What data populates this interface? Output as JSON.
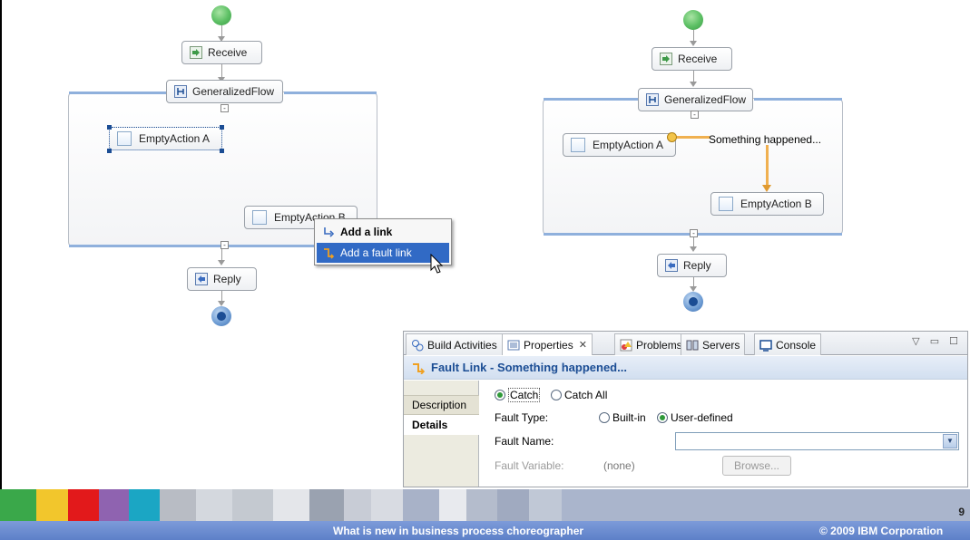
{
  "diagram_left": {
    "receive_label": "Receive",
    "flow_label": "GeneralizedFlow",
    "action_a_label": "EmptyAction A",
    "action_b_label": "EmptyAction B",
    "reply_label": "Reply",
    "context_menu": {
      "items": [
        "Add a link",
        "Add a fault link"
      ]
    }
  },
  "diagram_right": {
    "receive_label": "Receive",
    "flow_label": "GeneralizedFlow",
    "action_a_label": "EmptyAction A",
    "action_b_label": "EmptyAction B",
    "link_label": "Something happened...",
    "reply_label": "Reply"
  },
  "panel": {
    "tabs": [
      "Build Activities",
      "Properties",
      "Problems",
      "Servers",
      "Console"
    ],
    "active_tab": "Properties",
    "title": "Fault Link - Something happened...",
    "side_tabs": [
      "Description",
      "Details"
    ],
    "catch_options": [
      "Catch",
      "Catch All"
    ],
    "fault_type_label": "Fault Type:",
    "fault_type_options": [
      "Built-in",
      "User-defined"
    ],
    "fault_name_label": "Fault Name:",
    "fault_name_value": "",
    "fault_variable_label": "Fault Variable:",
    "fault_variable_value": "(none)",
    "browse_label": "Browse..."
  },
  "footer": {
    "page_number": "9",
    "title": "What is new in business process choreographer",
    "copyright": "© 2009 IBM Corporation"
  },
  "colors": {
    "accent": "#1b4d94",
    "menu_selection": "#316ac5",
    "footer_bar": "#6b8dd0"
  }
}
